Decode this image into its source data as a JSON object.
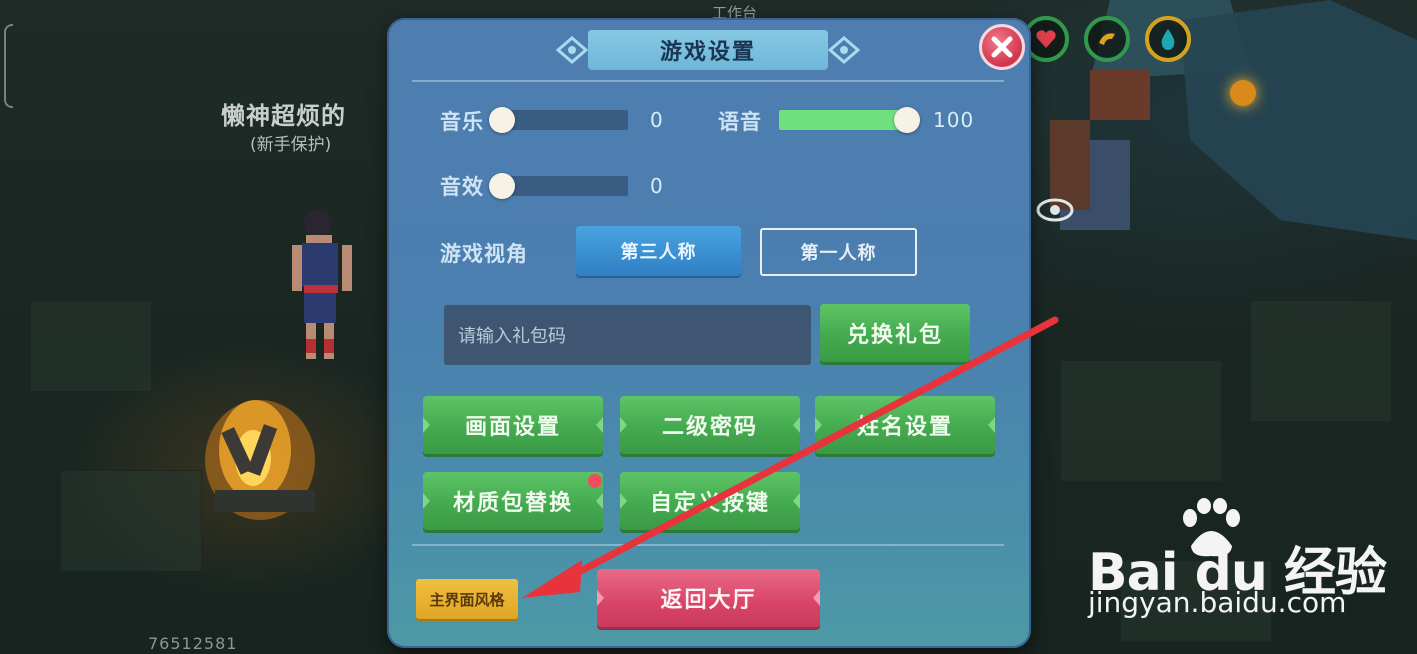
{
  "background": {
    "player_name": "懒神超烦的",
    "player_status": "(新手保护)",
    "player_id": "76512581",
    "top_label": "工作台"
  },
  "dialog": {
    "title": "游戏设置",
    "music": {
      "label": "音乐",
      "value": "0",
      "level": 0
    },
    "voice": {
      "label": "语音",
      "value": "100",
      "level": 1
    },
    "sfx": {
      "label": "音效",
      "value": "0",
      "level": 0
    },
    "view": {
      "label": "游戏视角",
      "options": [
        "第三人称",
        "第一人称"
      ],
      "selected": "第三人称"
    },
    "gift": {
      "placeholder": "请输入礼包码",
      "redeem_label": "兑换礼包"
    },
    "buttons": {
      "graphics": "画面设置",
      "second_password": "二级密码",
      "name_settings": "姓名设置",
      "texture_pack": "材质包替换",
      "custom_keys": "自定义按键",
      "main_style": "主界面风格",
      "back_lobby": "返回大厅"
    }
  },
  "watermark": {
    "logo": "Bai du 经验",
    "url": "jingyan.baidu.com"
  },
  "colors": {
    "dialog_bg": "#4a7fb0",
    "green_button": "#44aa4f",
    "red_button": "#d84466",
    "yellow_button": "#e0a623",
    "slider_fill": "#6ee07d",
    "arrow": "#e8323c"
  }
}
